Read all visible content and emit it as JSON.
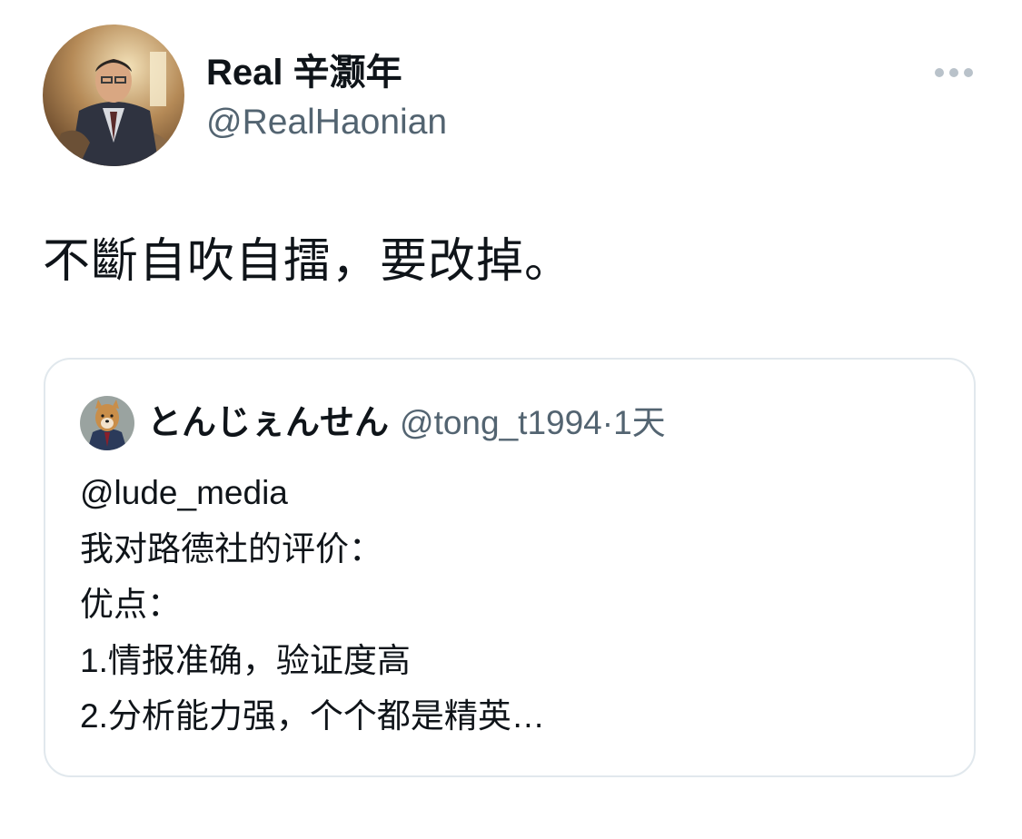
{
  "tweet": {
    "display_name": "Real 辛灏年",
    "handle": "@RealHaonian",
    "more_icon": "more-horizontal-icon",
    "text": "不斷自吹自擂，要改掉。"
  },
  "quote": {
    "display_name": "とんじぇんせん",
    "handle": "@tong_t1994",
    "separator": "·",
    "time": "1天",
    "lines": [
      "@lude_media",
      "我对路德社的评价：",
      "优点：",
      "1.情报准确，验证度高",
      "2.分析能力强，个个都是精英…"
    ]
  },
  "colors": {
    "text_primary": "#0f1419",
    "text_secondary": "#536471",
    "border": "#e1e8ed",
    "icon_gray": "#b9c2ca"
  }
}
